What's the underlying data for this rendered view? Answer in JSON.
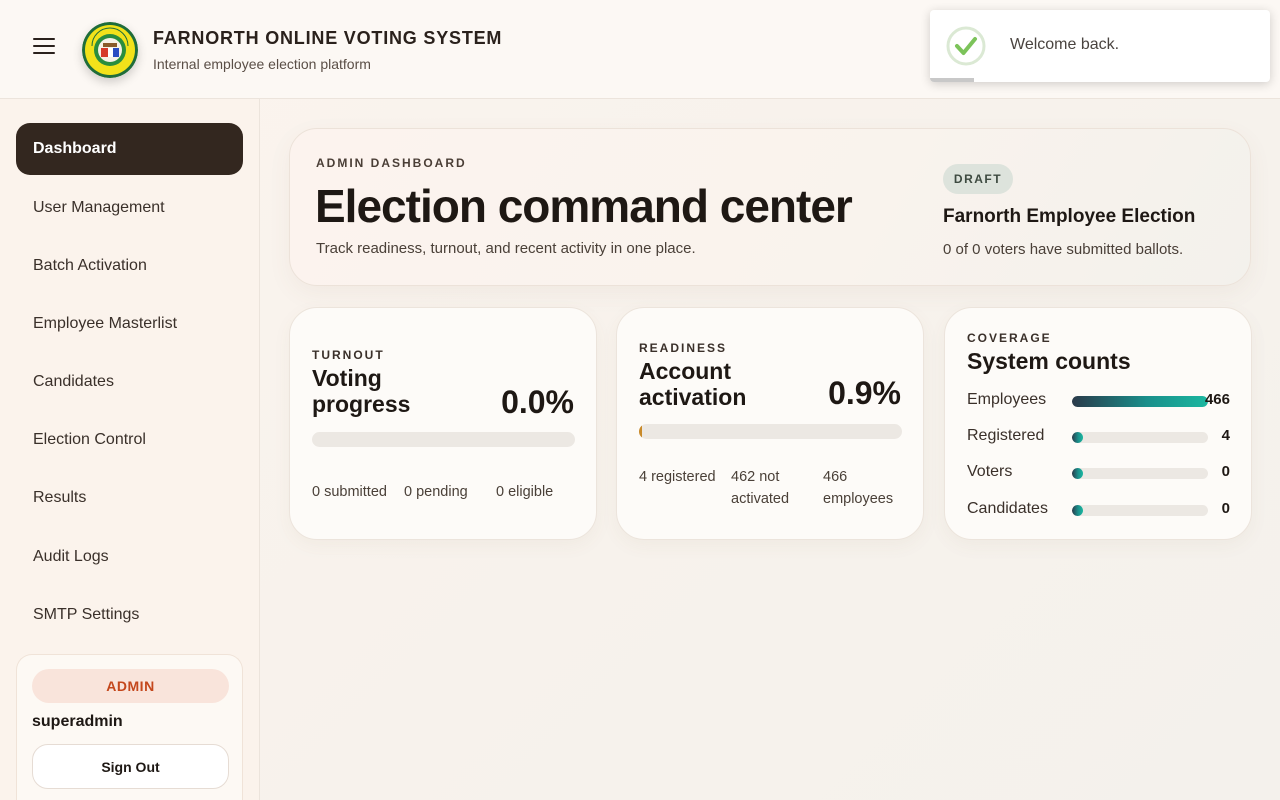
{
  "header": {
    "title": "FARNORTH ONLINE VOTING SYSTEM",
    "subtitle": "Internal employee election platform",
    "logo_text": "FAR NORTH LUZON"
  },
  "toast": {
    "message": "Welcome back.",
    "status": "success"
  },
  "sidebar": {
    "items": [
      {
        "label": "Dashboard",
        "active": true
      },
      {
        "label": "User Management"
      },
      {
        "label": "Batch Activation"
      },
      {
        "label": "Employee Masterlist"
      },
      {
        "label": "Candidates"
      },
      {
        "label": "Election Control"
      },
      {
        "label": "Results"
      },
      {
        "label": "Audit Logs"
      },
      {
        "label": "SMTP Settings"
      }
    ],
    "user": {
      "role": "ADMIN",
      "username": "superadmin",
      "signout_label": "Sign Out"
    }
  },
  "hero": {
    "eyebrow": "ADMIN DASHBOARD",
    "title": "Election command center",
    "subtitle": "Track readiness, turnout, and recent activity in one place.",
    "status": "DRAFT",
    "election_name": "Farnorth Employee Election",
    "election_summary": "0 of 0 voters have submitted ballots."
  },
  "turnout": {
    "eyebrow": "TURNOUT",
    "title_line1": "Voting",
    "title_line2": "progress",
    "percent": "0.0%",
    "progress": 0.0,
    "submitted": "0 submitted",
    "pending": "0 pending",
    "eligible": "0 eligible"
  },
  "readiness": {
    "eyebrow": "READINESS",
    "title_line1": "Account",
    "title_line2": "activation",
    "percent": "0.9%",
    "progress": 0.009,
    "registered": "4 registered",
    "not_activated_line1": "462 not",
    "not_activated_line2": "activated",
    "employees_line1": "466",
    "employees_line2": "employees"
  },
  "coverage": {
    "eyebrow": "COVERAGE",
    "title": "System counts",
    "rows": [
      {
        "label": "Employees",
        "value": "466",
        "fraction": 1.0
      },
      {
        "label": "Registered",
        "value": "4",
        "fraction": 0.009
      },
      {
        "label": "Voters",
        "value": "0",
        "fraction": 0
      },
      {
        "label": "Candidates",
        "value": "0",
        "fraction": 0
      }
    ]
  },
  "colors": {
    "accent_dark": "#33271f",
    "admin_badge": "#c4471c",
    "progress_gradient_start": "#2a3a4a",
    "progress_gradient_end": "#1bb7a0",
    "readiness_fill": "#c98a2a"
  }
}
